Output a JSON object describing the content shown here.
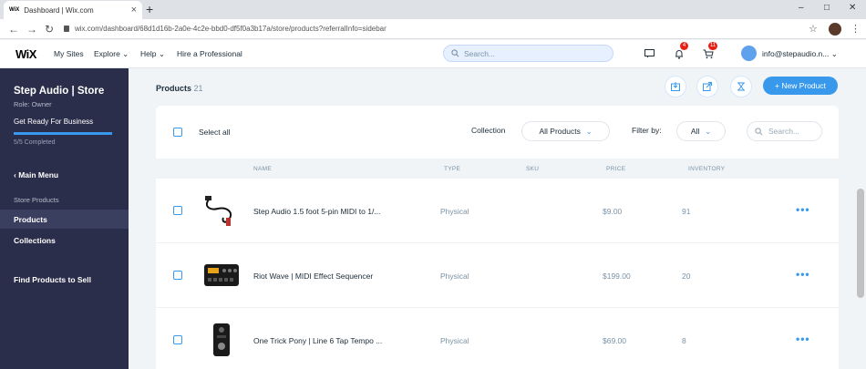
{
  "browser": {
    "tab_favicon": "WiX",
    "tab_title": "Dashboard | Wix.com",
    "tab_close": "×",
    "new_tab": "+",
    "url": "wix.com/dashboard/68d1d16b-2a0e-4c2e-bbd0-df5f0a3b17a/store/products?referralInfo=sidebar",
    "back": "←",
    "forward": "→",
    "reload": "↻",
    "star": "☆",
    "menu": "⋮",
    "minimize": "–",
    "maximize": "□",
    "close": "✕"
  },
  "wixbar": {
    "logo": "WiX",
    "nav": [
      "My Sites",
      "Explore ⌄",
      "Help ⌄",
      "Hire a Professional"
    ],
    "search_placeholder": "Search...",
    "notifications_count": "4",
    "cart_count": "11",
    "account_email": "info@stepaudio.n... ⌄"
  },
  "sidebar": {
    "site_name": "Step Audio | Store",
    "role": "Role: Owner",
    "setup_label": "Get Ready For Business",
    "progress_fraction": 1.0,
    "progress_text": "5/5 Completed",
    "main_menu": "‹  Main Menu",
    "section_label": "Store Products",
    "items": [
      "Products",
      "Collections"
    ],
    "find_products": "Find Products to Sell"
  },
  "main": {
    "title": "Products",
    "count": "21",
    "new_product_label": "+ New Product",
    "select_all": "Select all",
    "collection_label": "Collection",
    "collection_value": "All Products",
    "filter_label": "Filter by:",
    "filter_value": "All",
    "search_placeholder": "Search...",
    "columns": [
      "NAME",
      "TYPE",
      "SKU",
      "PRICE",
      "INVENTORY"
    ],
    "rows": [
      {
        "name": "Step Audio 1.5 foot 5-pin MIDI to 1/...",
        "type": "Physical",
        "sku": "",
        "price": "$9.00",
        "inventory": "91"
      },
      {
        "name": "Riot Wave | MIDI Effect Sequencer",
        "type": "Physical",
        "sku": "",
        "price": "$199.00",
        "inventory": "20"
      },
      {
        "name": "One Trick Pony | Line 6 Tap Tempo ...",
        "type": "Physical",
        "sku": "",
        "price": "$69.00",
        "inventory": "8"
      }
    ],
    "more_label": "•••"
  },
  "colors": {
    "accent": "#3899ec",
    "sidebar_bg": "#2b2e4a",
    "badge_red": "#e62214"
  }
}
